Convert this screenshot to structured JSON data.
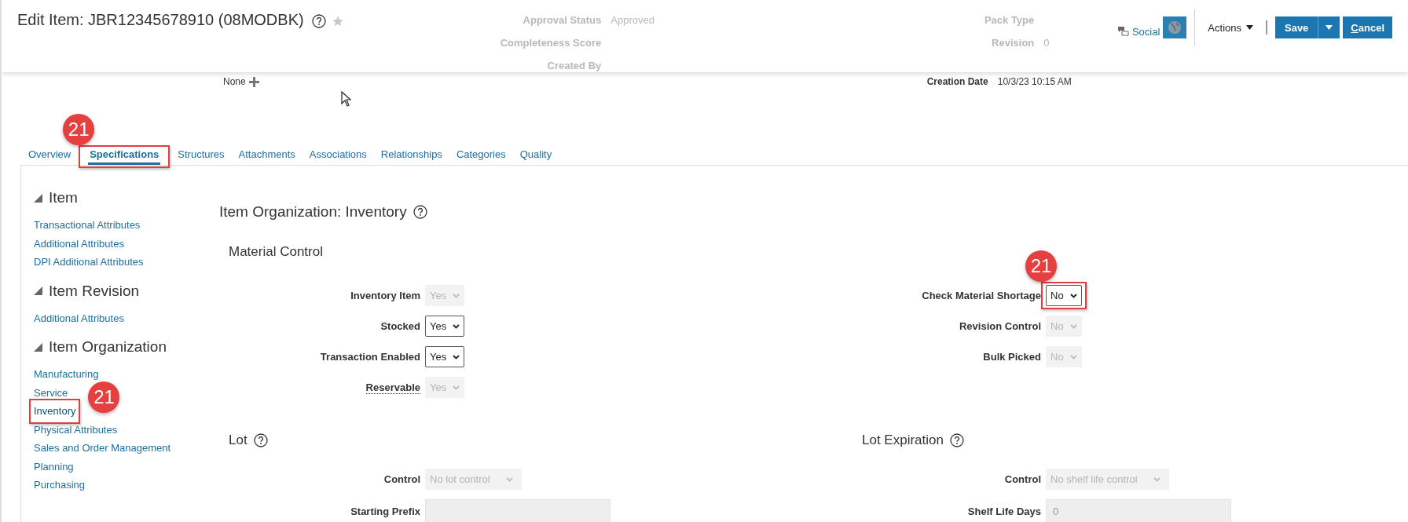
{
  "header": {
    "title": "Edit Item: JBR12345678910 (08MODBK)",
    "ghost_left": [
      {
        "label": "Approval Status",
        "value": "Approved"
      },
      {
        "label": "Completeness Score"
      },
      {
        "label": "Created By"
      }
    ],
    "ghost_right": [
      {
        "label": "Pack Type"
      },
      {
        "label": "Revision",
        "value": "0"
      }
    ],
    "social": "Social",
    "actions": "Actions",
    "save": "Save",
    "cancel": "Cancel"
  },
  "summary": {
    "catalog_value": "None",
    "creation_date_label": "Creation Date",
    "creation_date": "10/3/23 10:15 AM"
  },
  "tabs": [
    {
      "label": "Overview",
      "selected": false
    },
    {
      "label": "Specifications",
      "selected": true,
      "annotation": "21"
    },
    {
      "label": "Structures",
      "selected": false
    },
    {
      "label": "Attachments",
      "selected": false
    },
    {
      "label": "Associations",
      "selected": false
    },
    {
      "label": "Relationships",
      "selected": false
    },
    {
      "label": "Categories",
      "selected": false
    },
    {
      "label": "Quality",
      "selected": false
    }
  ],
  "nav": [
    {
      "title": "Item",
      "expanded": true,
      "items": [
        {
          "label": "Transactional Attributes",
          "selected": false
        },
        {
          "label": "Additional Attributes",
          "selected": false
        },
        {
          "label": "DPI Additional Attributes",
          "selected": false
        }
      ]
    },
    {
      "title": "Item Revision",
      "expanded": true,
      "items": [
        {
          "label": "Additional Attributes",
          "selected": false
        }
      ]
    },
    {
      "title": "Item Organization",
      "expanded": true,
      "items": [
        {
          "label": "Manufacturing",
          "selected": false
        },
        {
          "label": "Service",
          "selected": false
        },
        {
          "label": "Inventory",
          "selected": true,
          "annotation": "21"
        },
        {
          "label": "Physical Attributes",
          "selected": false
        },
        {
          "label": "Sales and Order Management",
          "selected": false
        },
        {
          "label": "Planning",
          "selected": false
        },
        {
          "label": "Purchasing",
          "selected": false
        }
      ]
    }
  ],
  "page_title": "Item Organization: Inventory",
  "groups": [
    {
      "title": "Material Control",
      "columns": [
        {
          "fields": [
            {
              "label": "Inventory Item",
              "kind": "select",
              "value": "Yes",
              "disabled": true,
              "help": false
            },
            {
              "label": "Stocked",
              "kind": "select",
              "value": "Yes",
              "disabled": false,
              "help": false
            },
            {
              "label": "Transaction Enabled",
              "kind": "select",
              "value": "Yes",
              "disabled": false,
              "help": false
            },
            {
              "label": "Reservable",
              "kind": "select",
              "value": "Yes",
              "disabled": true,
              "help": true
            }
          ]
        },
        {
          "fields": [
            {
              "label": "Check Material Shortage",
              "kind": "select",
              "value": "No",
              "disabled": false,
              "help": false,
              "annotation": "21"
            },
            {
              "label": "Revision Control",
              "kind": "select",
              "value": "No",
              "disabled": true,
              "help": false
            },
            {
              "label": "Bulk Picked",
              "kind": "select",
              "value": "No",
              "disabled": true,
              "help": false
            }
          ]
        }
      ]
    },
    {
      "columns": [
        {
          "title": "Lot",
          "help": true,
          "fields": [
            {
              "label": "Control",
              "kind": "select",
              "value": "No lot control",
              "disabled": true,
              "help": false
            },
            {
              "label": "Starting Prefix",
              "kind": "text",
              "disabled": true,
              "help": false
            }
          ]
        },
        {
          "title": "Lot Expiration",
          "help": true,
          "fields": [
            {
              "label": "Control",
              "kind": "select",
              "value": "No shelf life control",
              "disabled": true,
              "help": false
            },
            {
              "label": "Shelf Life Days",
              "kind": "text",
              "value": "0",
              "disabled": true,
              "help": false
            }
          ]
        }
      ]
    }
  ]
}
